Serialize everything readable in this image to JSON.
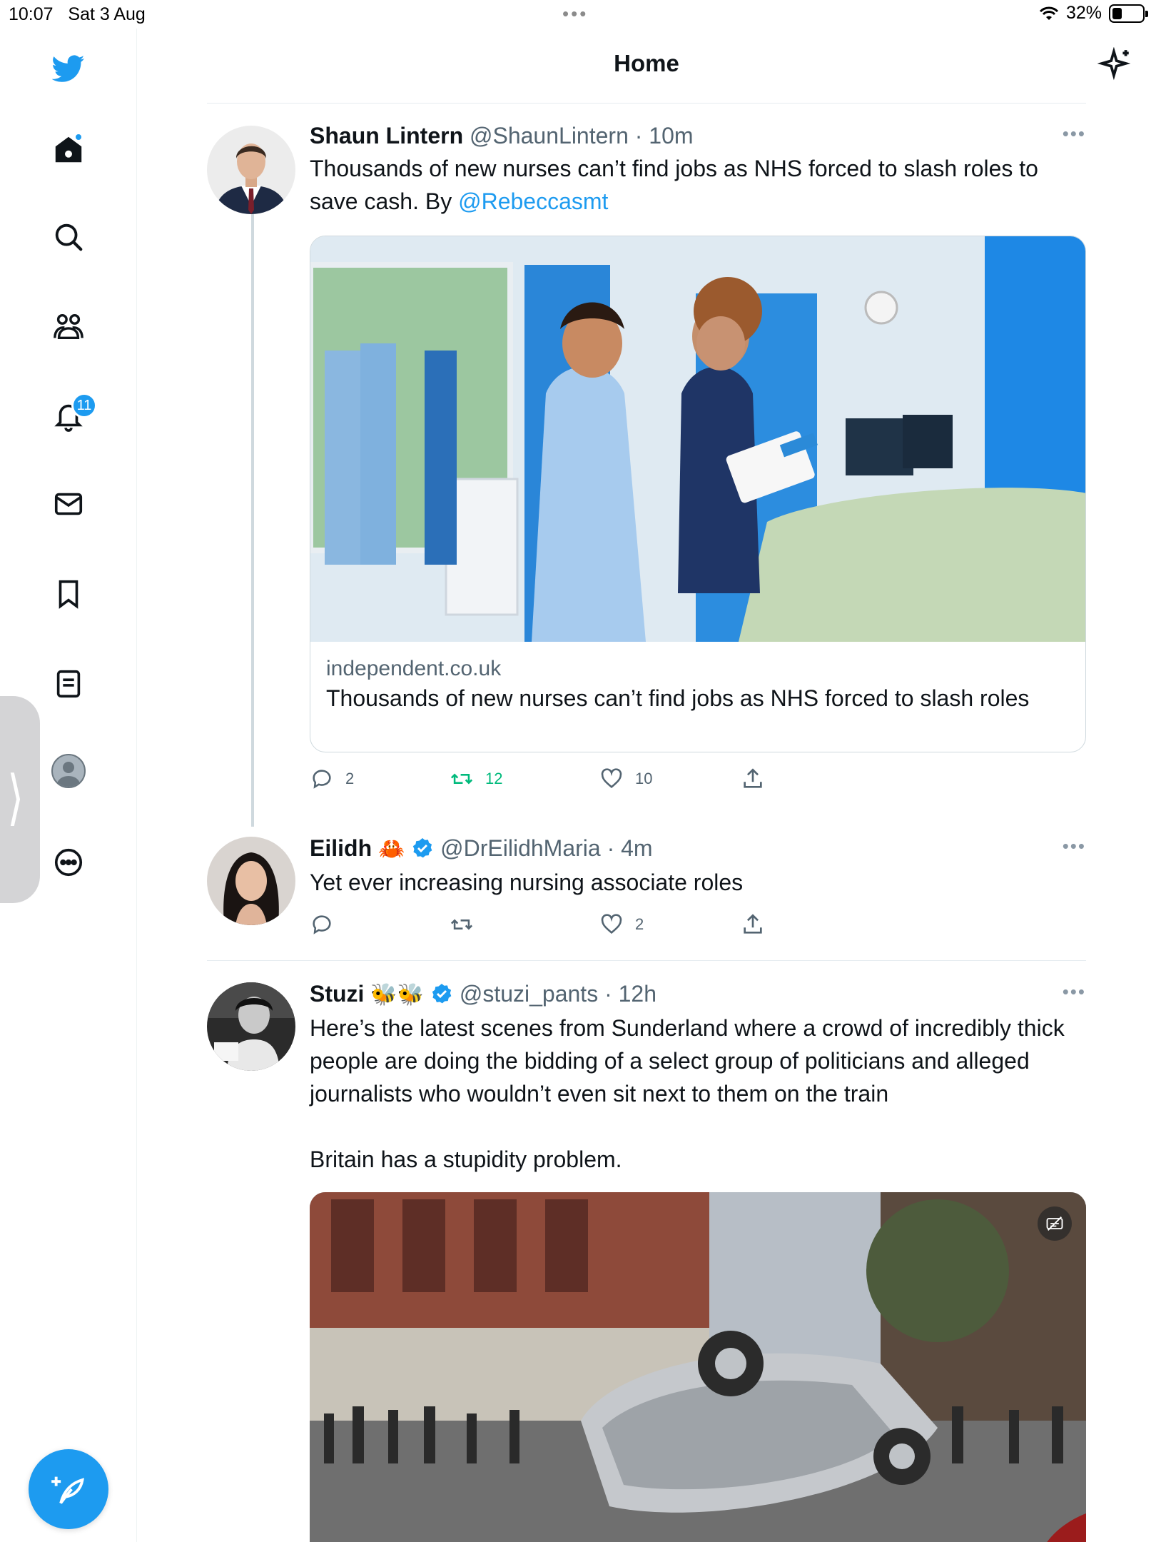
{
  "status_bar": {
    "time": "10:07",
    "date": "Sat 3 Aug",
    "battery": "32%",
    "battery_level": 0.32
  },
  "header": {
    "title": "Home"
  },
  "sidebar": {
    "notifications_count": "11"
  },
  "tweets": [
    {
      "name": "Shaun Lintern",
      "handle": "@ShaunLintern",
      "time": "· 10m",
      "text_1": "Thousands of new nurses can’t find jobs as NHS forced to slash roles to save cash. By ",
      "mention": "@Rebeccasmt",
      "card": {
        "domain": "independent.co.uk",
        "title": "Thousands of new nurses can’t find jobs as NHS forced to slash roles"
      },
      "replies": "2",
      "retweets": "12",
      "likes": "10"
    },
    {
      "name": "Eilidh",
      "emoji": "🦀",
      "handle": "@DrEilidhMaria",
      "time": "· 4m",
      "text": "Yet ever increasing nursing associate roles",
      "replies": "",
      "retweets": "",
      "likes": "2"
    },
    {
      "name": "Stuzi",
      "emoji": "🐝🐝",
      "handle": "@stuzi_pants",
      "time": "· 12h",
      "text_1": "Here’s the latest scenes from Sunderland where a crowd of incredibly thick people are doing the bidding of a select group of politicians and alleged journalists who wouldn’t even sit next to them on the train",
      "text_2": "Britain has a stupidity problem."
    }
  ],
  "colors": {
    "accent": "#1d9bf0",
    "retweet_active": "#00ba7c",
    "secondary_text": "#536471"
  }
}
